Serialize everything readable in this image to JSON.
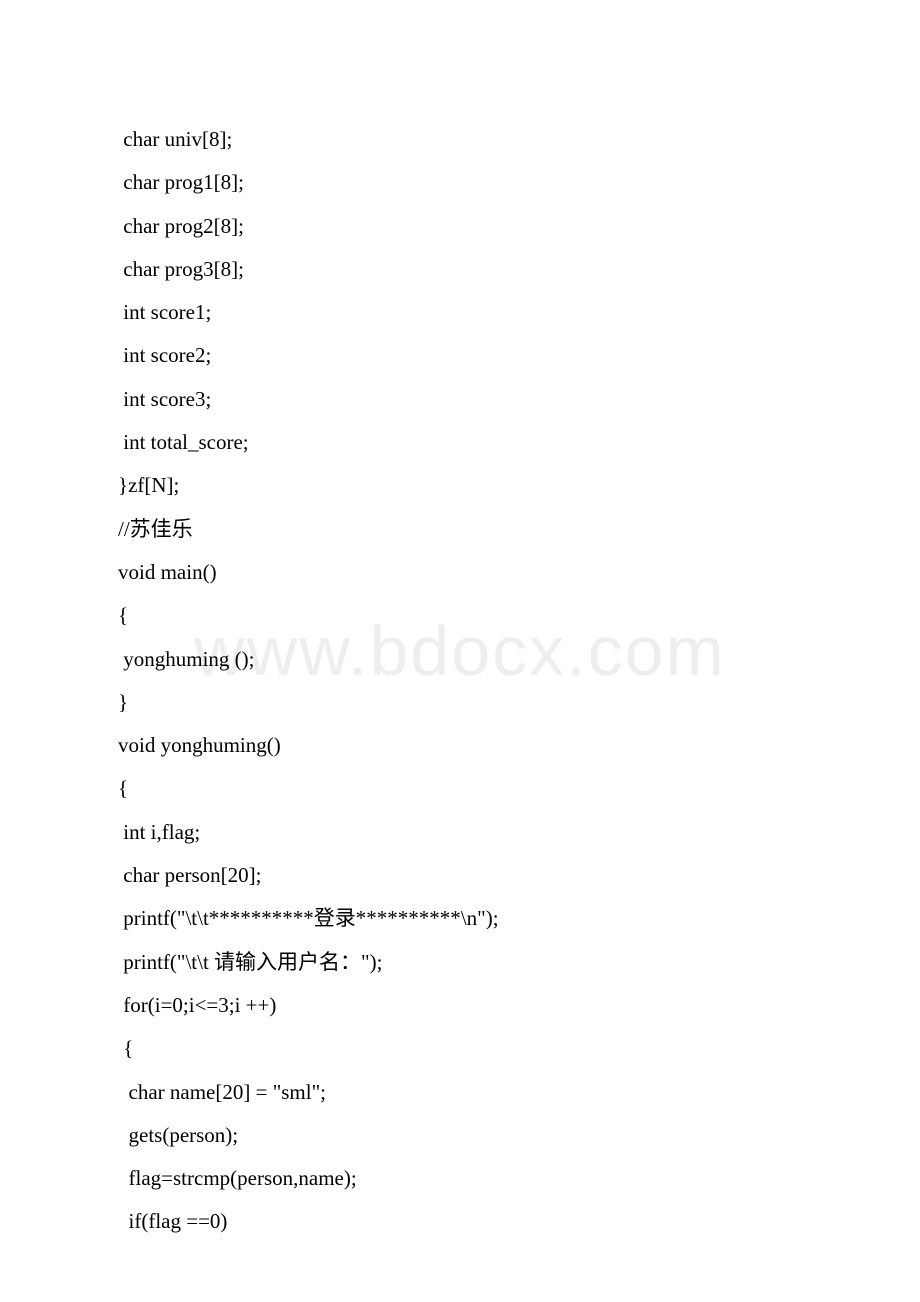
{
  "watermark": "www.bdocx.com",
  "lines": [
    " char univ[8];",
    " char prog1[8];",
    " char prog2[8];",
    " char prog3[8];",
    " int score1;",
    " int score2;",
    " int score3;",
    " int total_score;",
    "}zf[N];",
    "//苏佳乐",
    "void main()",
    "{",
    " yonghuming ();",
    "}",
    "void yonghuming()",
    "{",
    " int i,flag;",
    " char person[20];",
    " printf(\"\\t\\t**********登录**********\\n\");",
    " printf(\"\\t\\t 请输入用户名：\");",
    " for(i=0;i<=3;i ++)",
    " {",
    "  char name[20] = \"sml\";",
    "  gets(person);",
    "  flag=strcmp(person,name);",
    "  if(flag ==0)"
  ]
}
